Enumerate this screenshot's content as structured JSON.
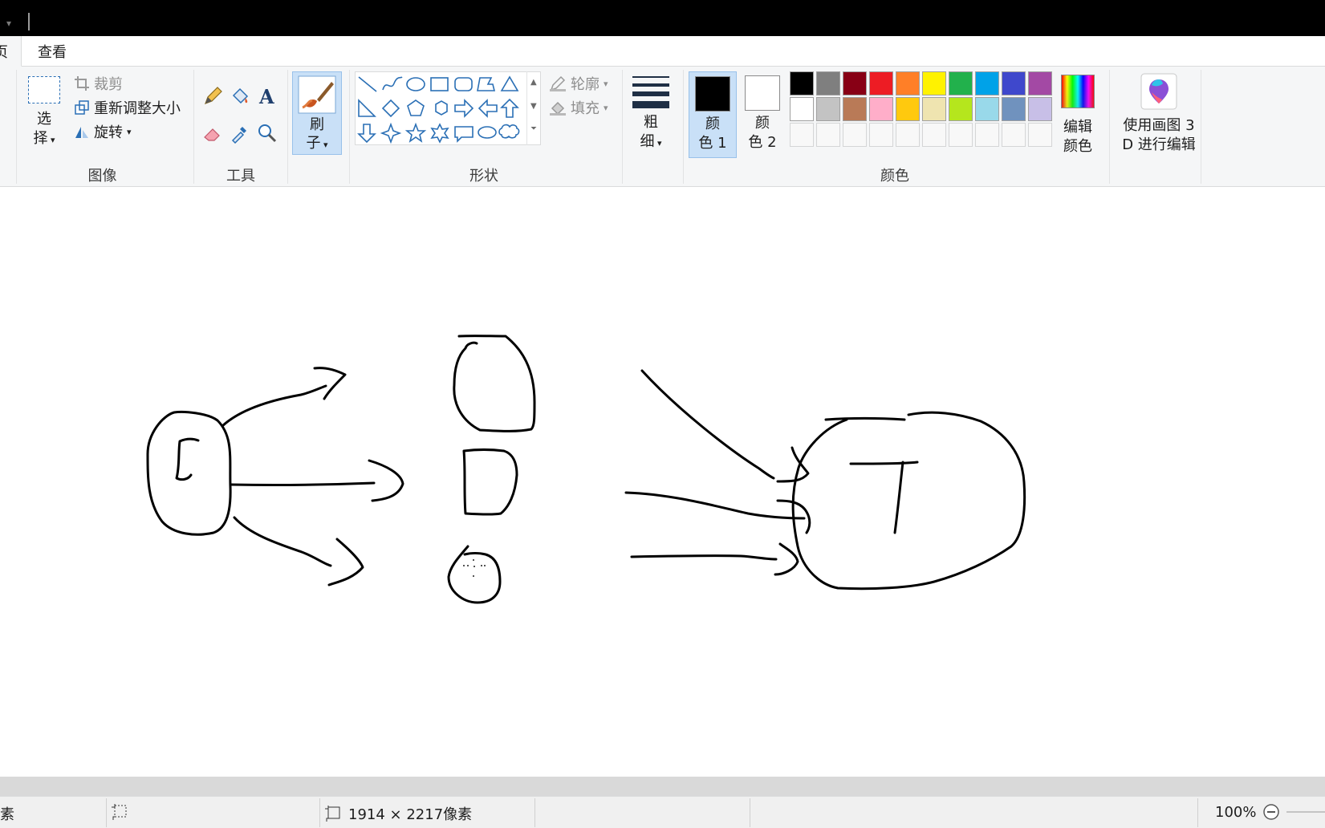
{
  "tabs": {
    "home_partial": "页",
    "view": "查看"
  },
  "groups": {
    "image": {
      "label": "图像",
      "select": {
        "line1": "选",
        "line2": "择"
      },
      "crop": "裁剪",
      "resize": "重新调整大小",
      "rotate": "旋转"
    },
    "tools": {
      "label": "工具"
    },
    "brush": {
      "line1": "刷",
      "line2": "子"
    },
    "shapes": {
      "label": "形状",
      "outline": "轮廓",
      "fill": "填充"
    },
    "size": {
      "line1": "粗",
      "line2": "细"
    },
    "colors": {
      "label": "颜色",
      "color1": {
        "line1": "颜",
        "line2": "色 1",
        "value": "#000000"
      },
      "color2": {
        "line1": "颜",
        "line2": "色 2",
        "value": "#ffffff"
      },
      "edit": {
        "line1": "编辑",
        "line2": "颜色"
      },
      "row1": [
        "#000000",
        "#7f7f7f",
        "#880015",
        "#ed1c24",
        "#ff7f27",
        "#fff200",
        "#22b14c",
        "#00a2e8",
        "#3f48cc",
        "#a349a4"
      ],
      "row2": [
        "#ffffff",
        "#c3c3c3",
        "#b97a57",
        "#ffaec9",
        "#ffc90e",
        "#efe4b0",
        "#b5e61d",
        "#99d9ea",
        "#7092be",
        "#c8bfe7"
      ]
    },
    "paint3d": {
      "line1": "使用画图 3",
      "line2": "D 进行编辑"
    }
  },
  "status": {
    "left_partial": "素",
    "image_size": "1914 × 2217像素",
    "zoom": "100%"
  }
}
